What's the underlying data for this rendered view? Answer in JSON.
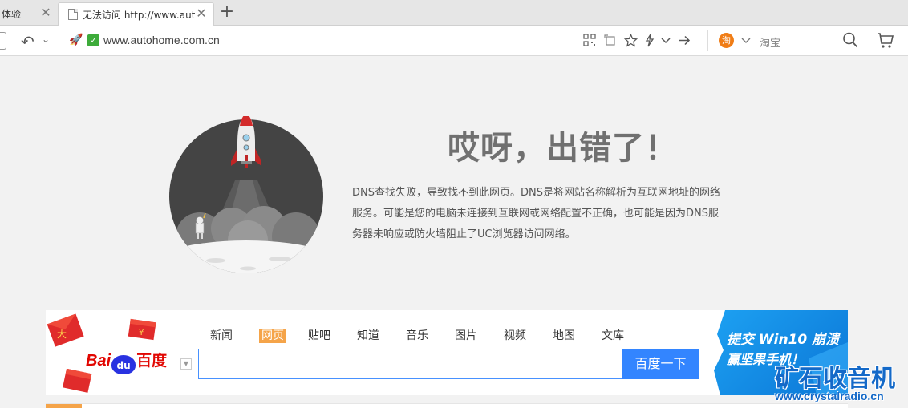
{
  "tabs": [
    {
      "label": "体验",
      "close": "✕"
    },
    {
      "label": "无法访问 http://www.autohome.com.cn",
      "close": "✕"
    }
  ],
  "new_tab": "+",
  "address_bar": {
    "url": "www.autohome.com.cn",
    "search_placeholder": "淘宝",
    "taobao_logo": "淘"
  },
  "error": {
    "title": "哎呀，出错了！",
    "description": "DNS查找失败，导致找不到此网页。DNS是将网站名称解析为互联网地址的网络服务。可能是您的电脑未连接到互联网或网络配置不正确，也可能是因为DNS服务器未响应或防火墙阻止了UC浏览器访问网络。"
  },
  "baidu": {
    "logo_bai": "Bai",
    "logo_du": "du",
    "logo_zh": "百度",
    "nav": [
      "新闻",
      "网页",
      "贴吧",
      "知道",
      "音乐",
      "图片",
      "视频",
      "地图",
      "文库"
    ],
    "active_nav": "网页",
    "search_button": "百度一下",
    "promo_line1": "提交 Win10 崩溃",
    "promo_line2": "赢坚果手机！",
    "envelope_chars": [
      "大",
      "¥"
    ]
  },
  "watermark": {
    "line1": "矿石收音机",
    "line2": "www.crystalradio.cn"
  },
  "colors": {
    "baidu_blue": "#3385ff",
    "baidu_red": "#e10601",
    "active_tab_orange": "#f5a449",
    "secure_green": "#3dab3a"
  }
}
